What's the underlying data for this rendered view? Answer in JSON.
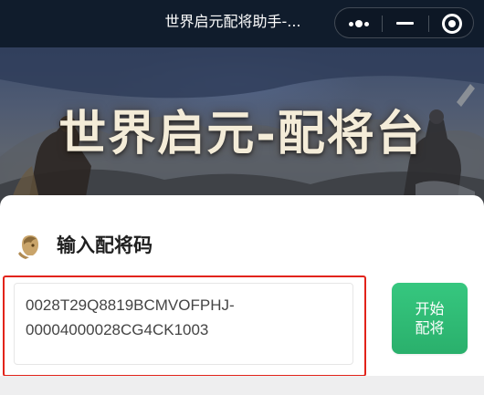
{
  "topbar": {
    "title": "世界启元配将助手-...",
    "more_icon": "more-dots-icon",
    "minimize_icon": "minimize-icon",
    "close_icon": "target-ring-icon"
  },
  "banner": {
    "title": "世界启元-配将台"
  },
  "card": {
    "section_title": "输入配将码",
    "section_icon": "warrior-head-icon",
    "code_line_1": "0028T29Q8819BCMVOFPHJ-",
    "code_line_2": "00004000028CG4CK1003",
    "start_button_line1": "开始",
    "start_button_line2": "配将"
  },
  "colors": {
    "topbar_bg": "#101c2c",
    "highlight_border": "#e2231a",
    "button_green": "#2ab06c",
    "banner_text": "#f4ecd8"
  }
}
